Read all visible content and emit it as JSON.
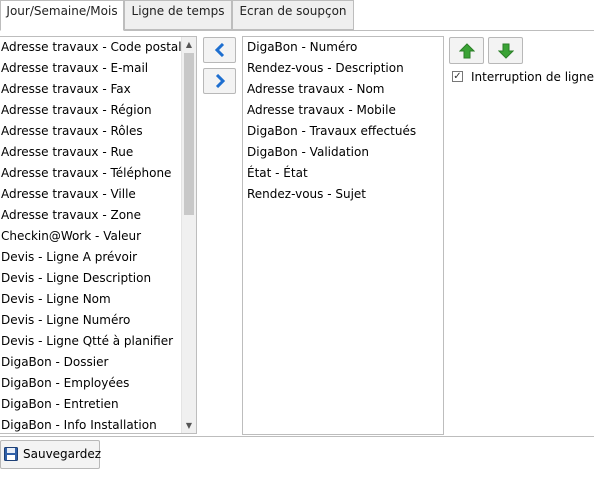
{
  "tabs": [
    {
      "label": "Jour/Semaine/Mois",
      "active": true
    },
    {
      "label": "Ligne de temps",
      "active": false
    },
    {
      "label": "Ecran de soupçon",
      "active": false
    }
  ],
  "available_fields": [
    "Adresse travaux - Code postal",
    "Adresse travaux - E-mail",
    "Adresse travaux - Fax",
    "Adresse travaux - Région",
    "Adresse travaux - Rôles",
    "Adresse travaux - Rue",
    "Adresse travaux - Téléphone",
    "Adresse travaux - Ville",
    "Adresse travaux - Zone",
    "Checkin@Work - Valeur",
    "Devis - Ligne A prévoir",
    "Devis - Ligne Description",
    "Devis - Ligne Nom",
    "Devis - Ligne Numéro",
    "Devis - Ligne Qtté à planifier",
    "DigaBon - Dossier",
    "DigaBon - Employées",
    "DigaBon - Entretien",
    "DigaBon - Info Installation"
  ],
  "selected_fields": [
    "DigaBon - Numéro",
    "Rendez-vous - Description",
    "Adresse travaux - Nom",
    "Adresse travaux - Mobile",
    "DigaBon - Travaux effectués",
    "DigaBon - Validation",
    "État - État",
    "Rendez-vous - Sujet"
  ],
  "buttons": {
    "move_left_icon": "chevron-left-icon",
    "move_right_icon": "chevron-right-icon",
    "move_up_icon": "green-arrow-up-icon",
    "move_down_icon": "green-arrow-down-icon",
    "save_label": "Sauvegardez",
    "save_icon": "floppy-disk-icon"
  },
  "options": {
    "line_break_label": "Interruption de ligne en",
    "line_break_checked": true
  },
  "colors": {
    "accent_blue": "#1e6fd0",
    "arrow_green": "#3aa335"
  }
}
